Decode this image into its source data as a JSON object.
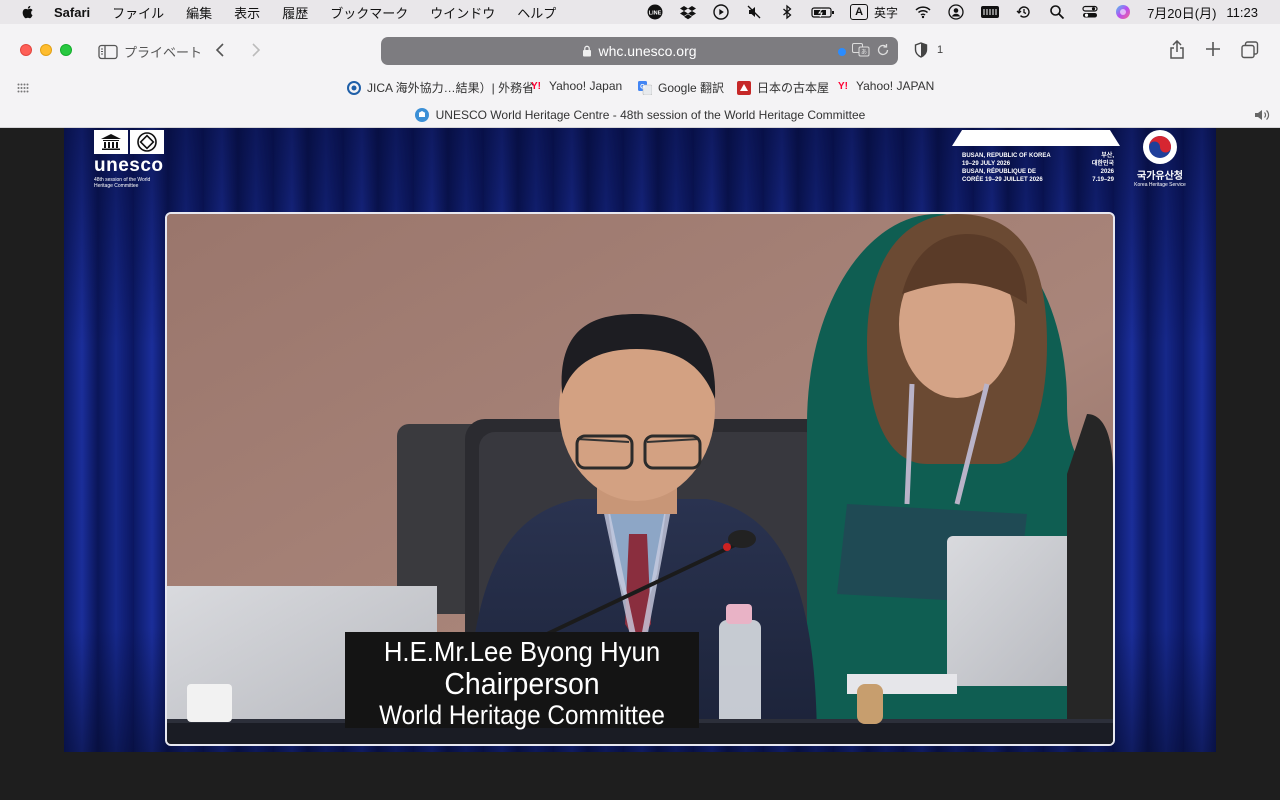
{
  "menubar": {
    "app_name": "Safari",
    "menus": [
      "ファイル",
      "編集",
      "表示",
      "履歴",
      "ブックマーク",
      "ウインドウ",
      "ヘルプ"
    ],
    "ime_label": "A",
    "ime_mode": "英字",
    "date": "7月20日(月)",
    "time": "11:23"
  },
  "toolbar": {
    "private_label": "プライベート",
    "url": "whc.unesco.org",
    "shield_count": "1"
  },
  "bookmarks": [
    {
      "label": "JICA 海外協力…結果）| 外務省",
      "icon": "jica-icon"
    },
    {
      "label": "Yahoo! Japan",
      "icon": "yahoo-icon"
    },
    {
      "label": "Google 翻訳",
      "icon": "google-translate-icon"
    },
    {
      "label": "日本の古本屋",
      "icon": "kosho-icon"
    },
    {
      "label": "Yahoo! JAPAN",
      "icon": "yahoo-icon"
    }
  ],
  "tab": {
    "title": "UNESCO World Heritage Centre - 48th session of the World Heritage Committee"
  },
  "video": {
    "unesco_word": "unesco",
    "unesco_sub": "48th session of the World Heritage Committee",
    "busan_left": [
      "BUSAN, REPUBLIC OF KOREA",
      "19–29 JULY 2026",
      "BUSAN, RÉPUBLIQUE DE",
      "CORÉE 19–29 JUILLET 2026"
    ],
    "busan_right": [
      "부산,",
      "대한민국",
      "2026",
      "7.19–29"
    ],
    "korea_name": "국가유산청",
    "korea_sub": "Korea Heritage Service",
    "nameplate": {
      "name": "H.E.Mr.Lee Byong Hyun",
      "role": "Chairperson",
      "committee": "World Heritage Committee"
    }
  },
  "colors": {
    "stage_blue": "#0c1a66",
    "url_bar": "#7d7c80",
    "wall": "#a07d74"
  }
}
